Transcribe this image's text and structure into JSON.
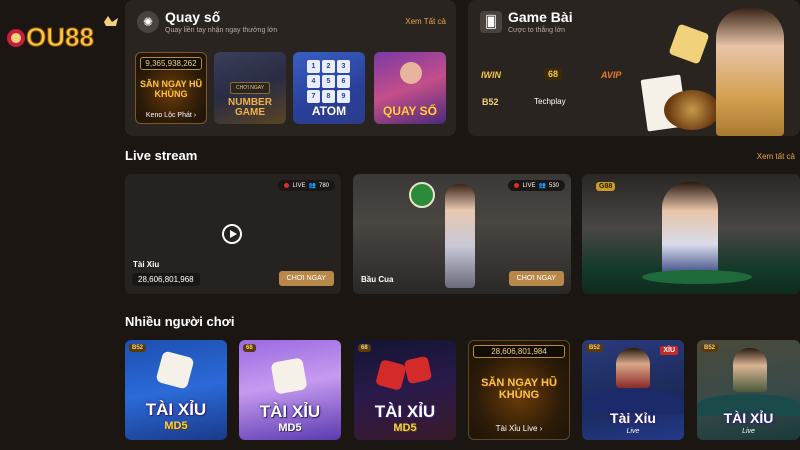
{
  "logo": {
    "text": "OU88"
  },
  "quay_so": {
    "title": "Quay số",
    "subtitle": "Quay liền tay nhận ngay thưởng lớn",
    "see_all": "Xem Tất cả",
    "icon": "lottery-wheel-icon",
    "games": [
      {
        "jackpot": "9,365,938,262",
        "art": "SĂN NGAY HŨ KHỦNG",
        "label": "Keno Lộc Phát ›"
      },
      {
        "play": "CHƠI NGAY",
        "art": "NUMBER GAME"
      },
      {
        "numbers": [
          "1",
          "2",
          "3",
          "4",
          "5",
          "6",
          "7",
          "8",
          "9"
        ],
        "art": "ATOM"
      },
      {
        "art": "QUAY SỐ"
      }
    ]
  },
  "game_bai": {
    "title": "Game Bài",
    "subtitle": "Cược to thắng lớn",
    "icon": "playing-cards-icon",
    "providers": [
      "IWIN",
      "68",
      "AVIP",
      "B52",
      "Techplay"
    ]
  },
  "live_stream": {
    "title": "Live stream",
    "see_all": "Xem tất cả",
    "cards": [
      {
        "live": "LIVE",
        "viewers": "780",
        "name": "Tài Xỉu",
        "amount": "28,606,801,968",
        "play": "CHƠI NGAY"
      },
      {
        "live": "LIVE",
        "viewers": "530",
        "name": "Bầu Cua",
        "play": "CHƠI NGAY"
      },
      {
        "badge": "G88"
      }
    ]
  },
  "popular": {
    "title": "Nhiều người chơi",
    "cards": [
      {
        "brand": "B52",
        "title": "TÀI XỈU",
        "sub": "MD5"
      },
      {
        "brand": "68",
        "title": "TÀI XỈU",
        "sub": "MD5"
      },
      {
        "brand": "68",
        "title": "TÀI XỈU",
        "sub": "MD5"
      },
      {
        "jackpot": "28,606,801,984",
        "art": "SĂN NGAY HŨ KHỦNG",
        "label": "Tài Xỉu Live ›"
      },
      {
        "brand": "B52",
        "title": "Tài Xỉu",
        "sub": "Live",
        "tag": "XỈU"
      },
      {
        "brand": "B52",
        "title": "TÀI XỈU",
        "sub": "Live"
      }
    ]
  }
}
